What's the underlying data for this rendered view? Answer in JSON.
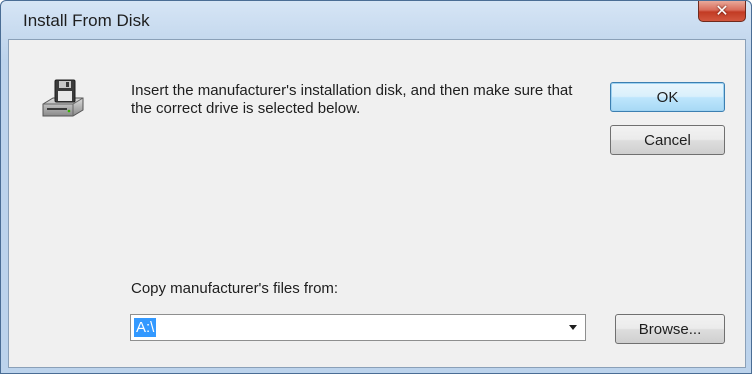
{
  "window": {
    "title": "Install From Disk",
    "close_glyph": "✕"
  },
  "dialog": {
    "icon": "floppy-disk-drive-icon",
    "message": "Insert the manufacturer's installation disk, and then make sure that the correct drive is selected below.",
    "ok_label": "OK",
    "cancel_label": "Cancel",
    "copy_label": "Copy manufacturer's files from:",
    "copy_from_value": "A:\\",
    "browse_label": "Browse..."
  },
  "colors": {
    "titlebar": "#c4d8ee",
    "close_button": "#c23b24",
    "client_background": "#f0f0f0",
    "selection": "#3399ff",
    "default_button_border": "#3c7fb1"
  }
}
